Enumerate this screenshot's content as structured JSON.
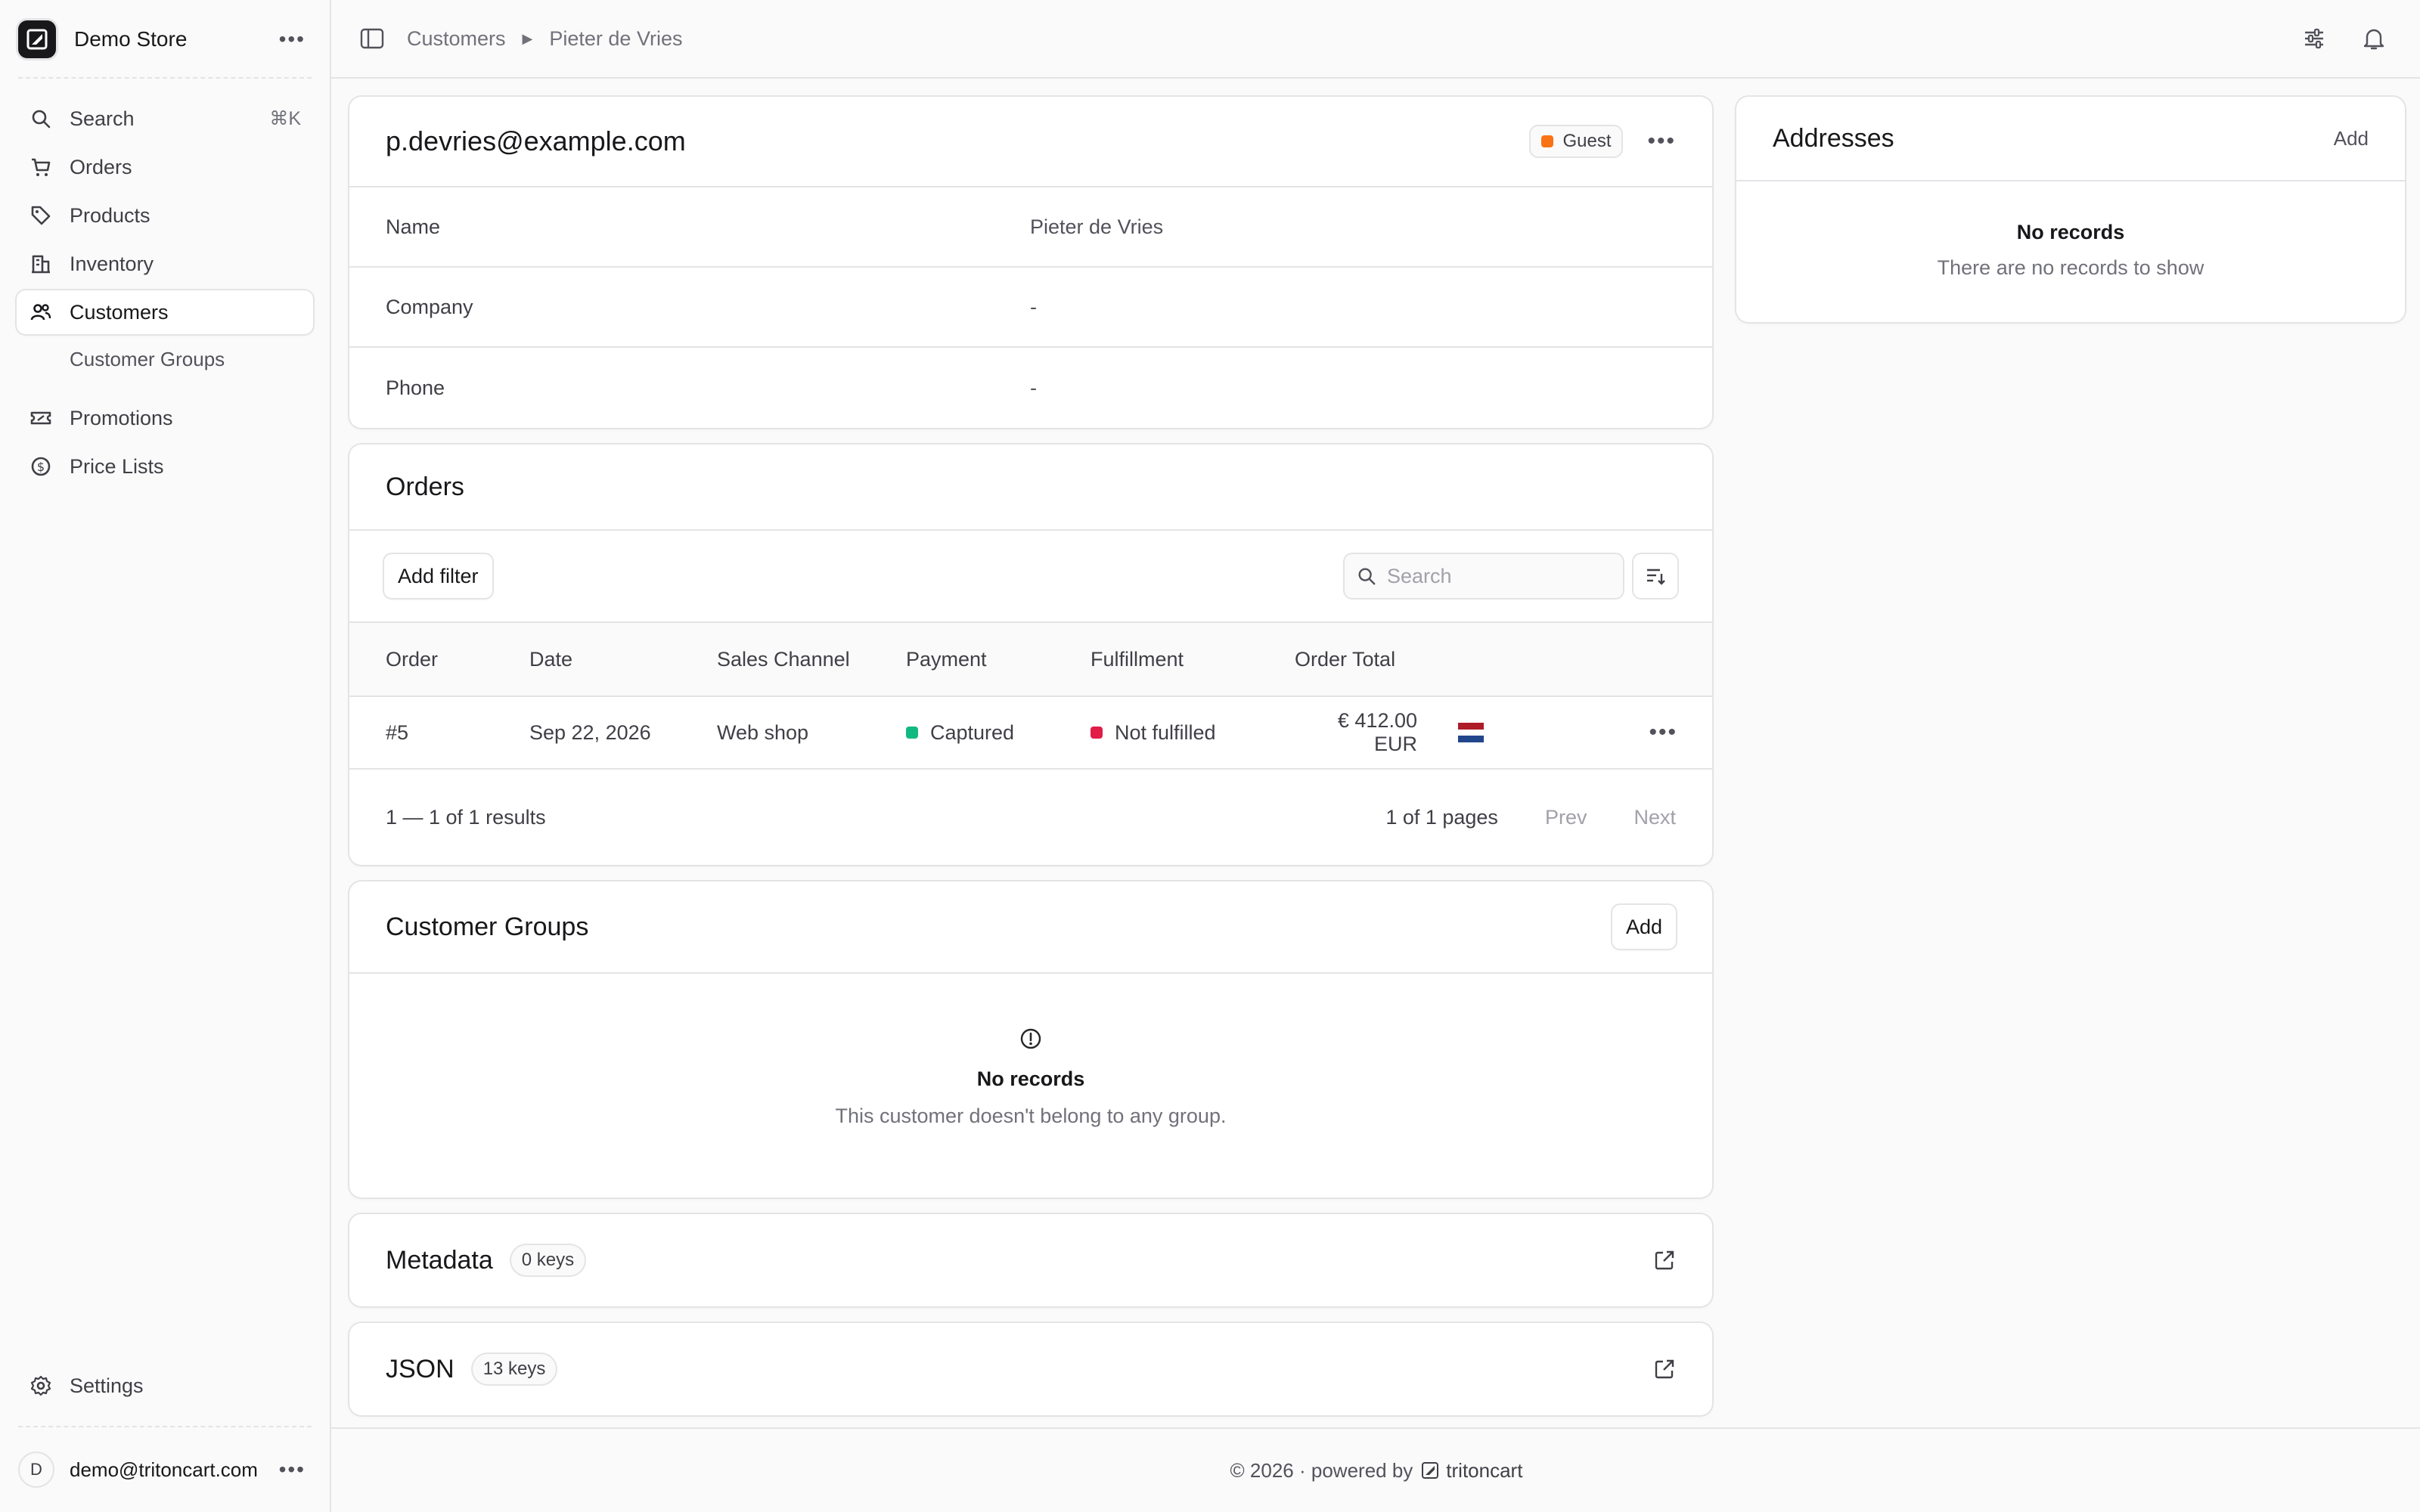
{
  "sidebar": {
    "store_name": "Demo Store",
    "items": [
      {
        "label": "Search",
        "shortcut": "⌘K"
      },
      {
        "label": "Orders"
      },
      {
        "label": "Products"
      },
      {
        "label": "Inventory"
      },
      {
        "label": "Customers"
      },
      {
        "label": "Customer Groups"
      },
      {
        "label": "Promotions"
      },
      {
        "label": "Price Lists"
      }
    ],
    "settings_label": "Settings",
    "user": {
      "initial": "D",
      "email": "demo@tritoncart.com"
    }
  },
  "breadcrumb": {
    "items": [
      "Customers",
      "Pieter de Vries"
    ]
  },
  "customer": {
    "email": "p.devries@example.com",
    "badge": "Guest",
    "fields": [
      {
        "label": "Name",
        "value": "Pieter de Vries"
      },
      {
        "label": "Company",
        "value": "-"
      },
      {
        "label": "Phone",
        "value": "-"
      }
    ]
  },
  "orders": {
    "title": "Orders",
    "add_filter": "Add filter",
    "search_placeholder": "Search",
    "columns": [
      "Order",
      "Date",
      "Sales Channel",
      "Payment",
      "Fulfillment",
      "Order Total"
    ],
    "rows": [
      {
        "order": "#5",
        "date": "Sep 22, 2026",
        "channel": "Web shop",
        "payment": "Captured",
        "fulfillment": "Not fulfilled",
        "total": "€ 412.00 EUR"
      }
    ],
    "results": "1 — 1 of 1 results",
    "pages": "1 of 1 pages",
    "prev": "Prev",
    "next": "Next"
  },
  "customer_groups": {
    "title": "Customer Groups",
    "add": "Add",
    "empty_title": "No records",
    "empty_sub": "This customer doesn't belong to any group."
  },
  "metadata": {
    "title": "Metadata",
    "keys": "0 keys"
  },
  "json": {
    "title": "JSON",
    "keys": "13 keys"
  },
  "addresses": {
    "title": "Addresses",
    "add": "Add",
    "empty_title": "No records",
    "empty_sub": "There are no records to show"
  },
  "footer": {
    "text": "© 2026 · powered by",
    "brand": "tritoncart"
  },
  "colors": {
    "captured": "#10b981",
    "not_fulfilled": "#e11d48",
    "guest": "#f97316"
  }
}
